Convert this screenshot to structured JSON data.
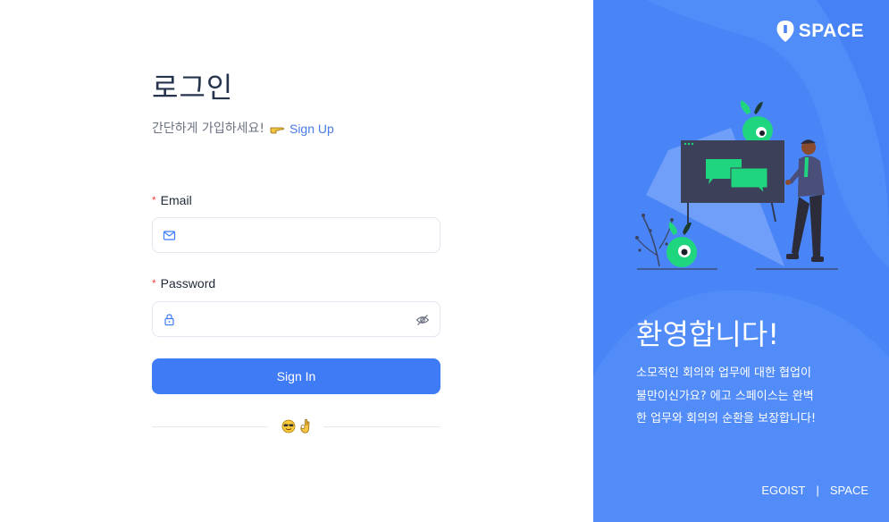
{
  "login": {
    "title": "로그인",
    "subtitle": "간단하게 가입하세요!",
    "signup_link": "Sign Up",
    "email": {
      "label": "Email",
      "required_mark": "*",
      "value": "",
      "placeholder": ""
    },
    "password": {
      "label": "Password",
      "required_mark": "*",
      "value": "",
      "placeholder": ""
    },
    "signin_label": "Sign In",
    "divider_icons": [
      "smiling-face-with-sunglasses-icon",
      "ok-hand-icon"
    ]
  },
  "hero": {
    "logo_text": "SPACE",
    "welcome": "환영합니다!",
    "description_lines": [
      "소모적인 회의와 업무에 대한 협업이",
      "불만이신가요? 에고 스페이스는 완벽",
      "한 업무와 회의의 순환을 보장합니다!"
    ],
    "footer": {
      "left": "EGOIST",
      "separator": "|",
      "right": "SPACE"
    }
  },
  "colors": {
    "accent": "#3f7bf5",
    "panel": "#4a85f7",
    "illustration_green": "#1fd67f",
    "required": "#ef4444",
    "link": "#4a7be8"
  }
}
